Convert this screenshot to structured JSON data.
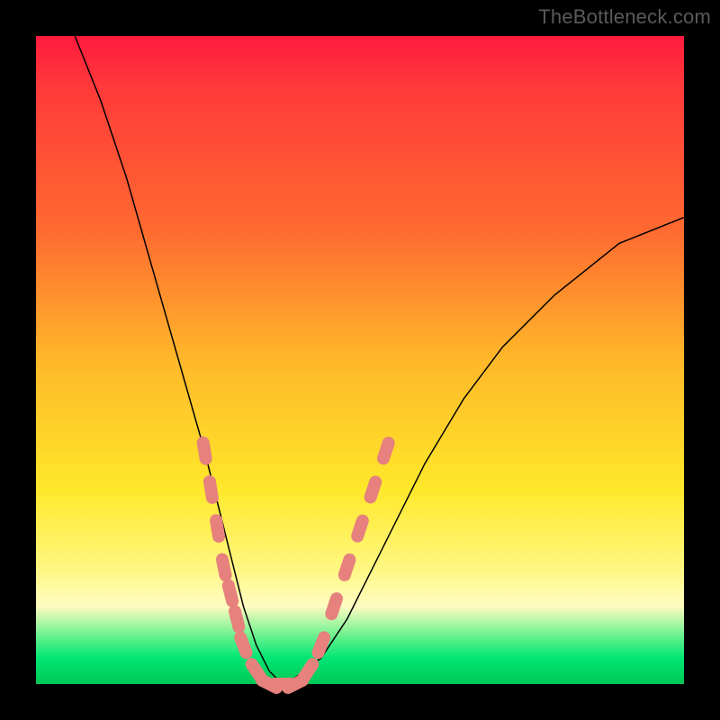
{
  "watermark": "TheBottleneck.com",
  "colors": {
    "frame": "#000000",
    "gradient_top": "#ff1a3c",
    "gradient_mid": "#ffe82a",
    "gradient_bottom": "#00c853",
    "curve": "#000000",
    "marker": "#e6817d"
  },
  "chart_data": {
    "type": "line",
    "title": "",
    "xlabel": "",
    "ylabel": "",
    "xlim": [
      0,
      100
    ],
    "ylim": [
      0,
      100
    ],
    "grid": false,
    "legend": false,
    "series": [
      {
        "name": "bottleneck-curve",
        "x": [
          6,
          10,
          14,
          18,
          22,
          26,
          28,
          30,
          32,
          34,
          36,
          38,
          40,
          44,
          48,
          52,
          56,
          60,
          66,
          72,
          80,
          90,
          100
        ],
        "y": [
          100,
          90,
          78,
          64,
          50,
          36,
          28,
          20,
          12,
          6,
          2,
          0,
          1,
          4,
          10,
          18,
          26,
          34,
          44,
          52,
          60,
          68,
          72
        ]
      }
    ],
    "markers": {
      "name": "highlight-dots",
      "color": "#e6817d",
      "points": [
        {
          "x": 26,
          "y": 36
        },
        {
          "x": 27,
          "y": 30
        },
        {
          "x": 28,
          "y": 24
        },
        {
          "x": 29,
          "y": 18
        },
        {
          "x": 30,
          "y": 14
        },
        {
          "x": 31,
          "y": 10
        },
        {
          "x": 32,
          "y": 6
        },
        {
          "x": 34,
          "y": 2
        },
        {
          "x": 36,
          "y": 0
        },
        {
          "x": 38,
          "y": 0
        },
        {
          "x": 40,
          "y": 0
        },
        {
          "x": 42,
          "y": 2
        },
        {
          "x": 44,
          "y": 6
        },
        {
          "x": 46,
          "y": 12
        },
        {
          "x": 48,
          "y": 18
        },
        {
          "x": 50,
          "y": 24
        },
        {
          "x": 52,
          "y": 30
        },
        {
          "x": 54,
          "y": 36
        }
      ]
    }
  }
}
